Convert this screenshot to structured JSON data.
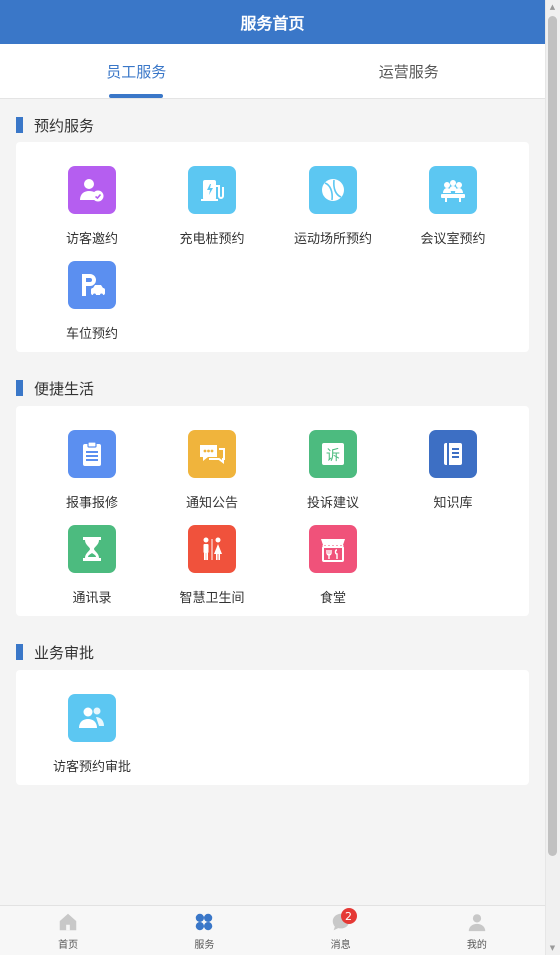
{
  "header": {
    "title": "服务首页"
  },
  "tabs": [
    {
      "label": "员工服务",
      "active": true
    },
    {
      "label": "运营服务",
      "active": false
    }
  ],
  "sections": [
    {
      "title": "预约服务",
      "items": [
        {
          "label": "访客邀约",
          "icon": "visitor-invite-icon",
          "color": "#b55ef0"
        },
        {
          "label": "充电桩预约",
          "icon": "charging-pile-icon",
          "color": "#5cc7f2"
        },
        {
          "label": "运动场所预约",
          "icon": "sports-ball-icon",
          "color": "#5cc7f2"
        },
        {
          "label": "会议室预约",
          "icon": "meeting-room-icon",
          "color": "#5cc7f2"
        },
        {
          "label": "车位预约",
          "icon": "parking-icon",
          "color": "#5b8ff0"
        }
      ]
    },
    {
      "title": "便捷生活",
      "items": [
        {
          "label": "报事报修",
          "icon": "clipboard-icon",
          "color": "#5b8ff0"
        },
        {
          "label": "通知公告",
          "icon": "message-bubble-icon",
          "color": "#f0b43c"
        },
        {
          "label": "投诉建议",
          "icon": "complaint-icon",
          "color": "#4cbb7f"
        },
        {
          "label": "知识库",
          "icon": "knowledge-book-icon",
          "color": "#3d6fc4"
        },
        {
          "label": "通讯录",
          "icon": "hourglass-icon",
          "color": "#4cbb7f"
        },
        {
          "label": "智慧卫生间",
          "icon": "restroom-icon",
          "color": "#f0523c"
        },
        {
          "label": "食堂",
          "icon": "canteen-icon",
          "color": "#f0527a"
        }
      ]
    },
    {
      "title": "业务审批",
      "items": [
        {
          "label": "访客预约审批",
          "icon": "visitor-approval-icon",
          "color": "#5cc7f2"
        }
      ]
    }
  ],
  "bottom_nav": [
    {
      "label": "首页",
      "icon": "home-icon",
      "active": false
    },
    {
      "label": "服务",
      "icon": "service-grid-icon",
      "active": true
    },
    {
      "label": "消息",
      "icon": "message-icon",
      "active": false,
      "badge": "2"
    },
    {
      "label": "我的",
      "icon": "user-icon",
      "active": false
    }
  ],
  "colors": {
    "primary": "#3a77c8",
    "background": "#f4f4f4",
    "badge": "#e53935"
  }
}
